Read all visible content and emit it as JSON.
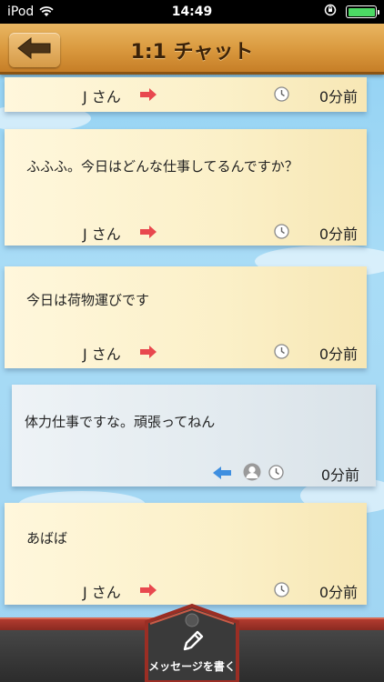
{
  "status_bar": {
    "carrier": "iPod",
    "time": "14:49"
  },
  "nav": {
    "title": "1:1 チャット"
  },
  "messages": [
    {
      "text": "",
      "sender": "J さん",
      "time_ago": "0分前",
      "direction": "incoming"
    },
    {
      "text": "ふふふ。今日はどんな仕事してるんですか？",
      "sender": "J さん",
      "time_ago": "0分前",
      "direction": "incoming"
    },
    {
      "text": "今日は荷物運びです",
      "sender": "J さん",
      "time_ago": "0分前",
      "direction": "incoming"
    },
    {
      "text": "体力仕事ですな。頑張ってねん",
      "sender": "",
      "time_ago": "0分前",
      "direction": "outgoing"
    },
    {
      "text": "あばば",
      "sender": "J さん",
      "time_ago": "0分前",
      "direction": "incoming"
    }
  ],
  "bottom_bar": {
    "write_label": "メッセージを書く"
  },
  "colors": {
    "sky": "#9fd4f2",
    "nav_wood": "#d9983d",
    "arrow_red": "#e8484e",
    "arrow_blue": "#3f8fe0"
  }
}
